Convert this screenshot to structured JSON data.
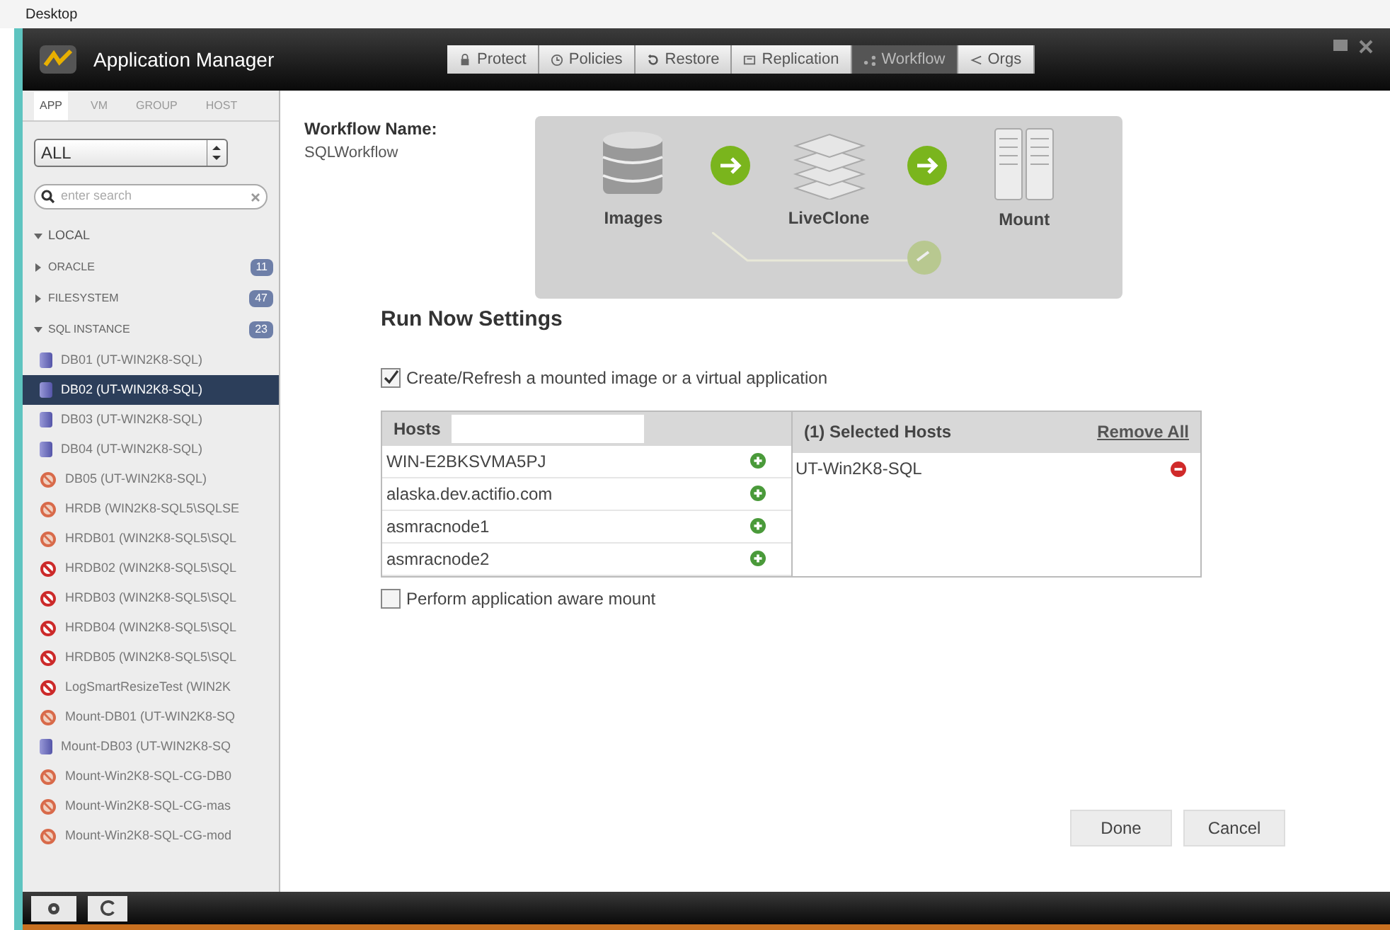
{
  "desktop_bar": {
    "title": "Desktop"
  },
  "header": {
    "title": "Application Manager",
    "tabs": [
      {
        "label": "Protect",
        "kind": "lock",
        "selected": false
      },
      {
        "label": "Policies",
        "kind": "clock",
        "selected": false
      },
      {
        "label": "Restore",
        "kind": "undo",
        "selected": false
      },
      {
        "label": "Replication",
        "kind": "copy",
        "selected": false
      },
      {
        "label": "Workflow",
        "kind": "flow",
        "selected": true
      },
      {
        "label": "Orgs",
        "kind": "share",
        "selected": false
      }
    ]
  },
  "sidebar": {
    "tabs": [
      {
        "label": "APP",
        "selected": true
      },
      {
        "label": "VM",
        "selected": false
      },
      {
        "label": "GROUP",
        "selected": false
      },
      {
        "label": "HOST",
        "selected": false
      }
    ],
    "filter": {
      "value": "ALL"
    },
    "search": {
      "placeholder": "enter search"
    },
    "tree": [
      {
        "label": "LOCAL",
        "expanded": true,
        "children": [
          {
            "label": "ORACLE",
            "expanded": false,
            "count": "11"
          },
          {
            "label": "FILESYSTEM",
            "expanded": false,
            "count": "47"
          },
          {
            "label": "SQL INSTANCE",
            "expanded": true,
            "count": "23",
            "children": [
              {
                "label": "DB01 (UT-WIN2K8-SQL)",
                "kind": "db",
                "selected": false
              },
              {
                "label": "DB02 (UT-WIN2K8-SQL)",
                "kind": "db",
                "selected": true
              },
              {
                "label": "DB03 (UT-WIN2K8-SQL)",
                "kind": "db",
                "selected": false
              },
              {
                "label": "DB04 (UT-WIN2K8-SQL)",
                "kind": "db",
                "selected": false
              },
              {
                "label": "DB05 (UT-WIN2K8-SQL)",
                "kind": "warning",
                "selected": false
              },
              {
                "label": "HRDB (WIN2K8-SQL5\\SQLSE",
                "kind": "warning",
                "selected": false
              },
              {
                "label": "HRDB01 (WIN2K8-SQL5\\SQL",
                "kind": "warning",
                "selected": false
              },
              {
                "label": "HRDB02 (WIN2K8-SQL5\\SQL",
                "kind": "error",
                "selected": false
              },
              {
                "label": "HRDB03 (WIN2K8-SQL5\\SQL",
                "kind": "error",
                "selected": false
              },
              {
                "label": "HRDB04 (WIN2K8-SQL5\\SQL",
                "kind": "error",
                "selected": false
              },
              {
                "label": "HRDB05 (WIN2K8-SQL5\\SQL",
                "kind": "error",
                "selected": false
              },
              {
                "label": "LogSmartResizeTest (WIN2K",
                "kind": "error",
                "selected": false
              },
              {
                "label": "Mount-DB01 (UT-WIN2K8-SQ",
                "kind": "warning",
                "selected": false
              },
              {
                "label": "Mount-DB03 (UT-WIN2K8-SQ",
                "kind": "db",
                "selected": false
              },
              {
                "label": "Mount-Win2K8-SQL-CG-DB0",
                "kind": "warning",
                "selected": false
              },
              {
                "label": "Mount-Win2K8-SQL-CG-mas",
                "kind": "warning",
                "selected": false
              },
              {
                "label": "Mount-Win2K8-SQL-CG-mod",
                "kind": "warning",
                "selected": false
              }
            ]
          }
        ]
      }
    ]
  },
  "workflow": {
    "name_label": "Workflow Name:",
    "name": "SQLWorkflow",
    "stages": [
      {
        "label": "Images",
        "kind": "database"
      },
      {
        "label": "LiveClone",
        "kind": "layers"
      },
      {
        "label": "Mount",
        "kind": "servers"
      }
    ]
  },
  "run_now": {
    "title": "Run Now Settings",
    "create_refresh": {
      "label": "Create/Refresh a mounted image or a virtual application",
      "checked": true
    },
    "hosts": {
      "title": "Hosts",
      "items": [
        "WIN-E2BKSVMA5PJ",
        "alaska.dev.actifio.com",
        "asmracnode1",
        "asmracnode2"
      ]
    },
    "selected_hosts": {
      "title": "(1) Selected Hosts",
      "remove_all": "Remove All",
      "items": [
        "UT-Win2K8-SQL"
      ]
    },
    "app_aware": {
      "label": "Perform application aware mount",
      "checked": false
    },
    "buttons": [
      "Done",
      "Cancel"
    ]
  }
}
